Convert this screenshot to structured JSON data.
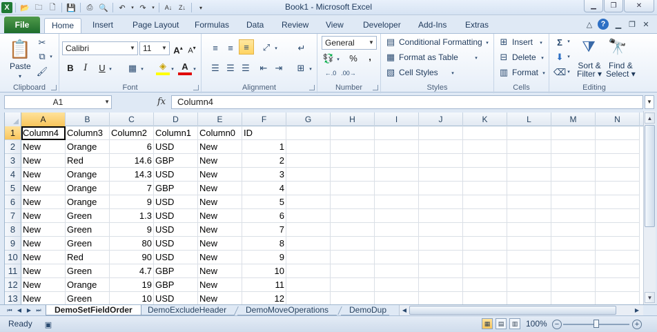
{
  "window": {
    "title": "Book1  -  Microsoft Excel",
    "app_icon": "X"
  },
  "ribbon_tabs": [
    "File",
    "Home",
    "Insert",
    "Page Layout",
    "Formulas",
    "Data",
    "Review",
    "View",
    "Developer",
    "Add-Ins",
    "Extras"
  ],
  "active_tab": "Home",
  "groups": {
    "clipboard": {
      "label": "Clipboard",
      "paste": "Paste"
    },
    "font": {
      "label": "Font",
      "font_name": "Calibri",
      "font_size": "11",
      "bold": "B",
      "italic": "I",
      "underline": "U"
    },
    "alignment": {
      "label": "Alignment"
    },
    "number": {
      "label": "Number",
      "format": "General",
      "percent": "%",
      "comma": ","
    },
    "styles": {
      "label": "Styles",
      "conditional": "Conditional Formatting",
      "format_table": "Format as Table",
      "cell_styles": "Cell Styles"
    },
    "cells": {
      "label": "Cells",
      "insert": "Insert",
      "delete": "Delete",
      "format": "Format"
    },
    "editing": {
      "label": "Editing",
      "sigma": "Σ",
      "sort_1": "Sort &",
      "sort_2": "Filter",
      "find_1": "Find &",
      "find_2": "Select"
    }
  },
  "formula_bar": {
    "name_box": "A1",
    "fx": "fx",
    "formula": "Column4"
  },
  "columns": [
    "A",
    "B",
    "C",
    "D",
    "E",
    "F",
    "G",
    "H",
    "I",
    "J",
    "K",
    "L",
    "M",
    "N"
  ],
  "rows": [
    [
      "Column4",
      "Column3",
      "Column2",
      "Column1",
      "Column0",
      "ID"
    ],
    [
      "New",
      "Orange",
      "6",
      "USD",
      "New",
      "1"
    ],
    [
      "New",
      "Red",
      "14.6",
      "GBP",
      "New",
      "2"
    ],
    [
      "New",
      "Orange",
      "14.3",
      "USD",
      "New",
      "3"
    ],
    [
      "New",
      "Orange",
      "7",
      "GBP",
      "New",
      "4"
    ],
    [
      "New",
      "Orange",
      "9",
      "USD",
      "New",
      "5"
    ],
    [
      "New",
      "Green",
      "1.3",
      "USD",
      "New",
      "6"
    ],
    [
      "New",
      "Green",
      "9",
      "USD",
      "New",
      "7"
    ],
    [
      "New",
      "Green",
      "80",
      "USD",
      "New",
      "8"
    ],
    [
      "New",
      "Red",
      "90",
      "USD",
      "New",
      "9"
    ],
    [
      "New",
      "Green",
      "4.7",
      "GBP",
      "New",
      "10"
    ],
    [
      "New",
      "Orange",
      "19",
      "GBP",
      "New",
      "11"
    ],
    [
      "New",
      "Green",
      "10",
      "USD",
      "New",
      "12"
    ]
  ],
  "sheets": [
    "DemoSetFieldOrder",
    "DemoExcludeHeader",
    "DemoMoveOperations",
    "DemoDup"
  ],
  "active_sheet": "DemoSetFieldOrder",
  "status": {
    "mode": "Ready",
    "zoom": "100%",
    "zoom_fraction": 0.5
  }
}
